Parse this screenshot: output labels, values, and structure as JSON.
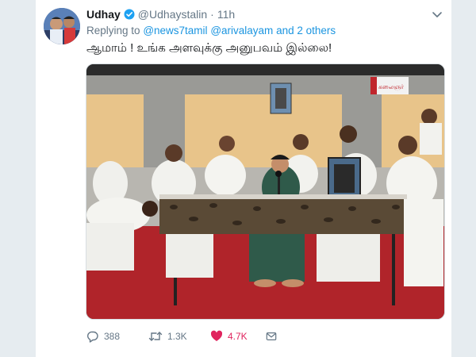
{
  "tweet": {
    "display_name": "Udhay",
    "handle": "@Udhaystalin",
    "separator": "·",
    "time": "11h",
    "reply_prefix": "Replying to",
    "reply_user_1": "@news7tamil",
    "reply_user_2": "@arivalayam",
    "reply_suffix": "and 2 others",
    "text": "ஆமாம் ! உங்க அளவுக்கு அனுபவம் இல்லை!"
  },
  "media": {
    "banner_text": "கலைஞர்"
  },
  "actions": {
    "reply_count": "388",
    "retweet_count": "1.3K",
    "like_count": "4.7K"
  },
  "colors": {
    "accent": "#1b95e0",
    "like": "#e0245e",
    "muted": "#657786",
    "text": "#14171a"
  },
  "icons": [
    "verified-badge-icon",
    "chevron-down-icon",
    "reply-icon",
    "retweet-icon",
    "heart-icon",
    "direct-message-icon"
  ]
}
